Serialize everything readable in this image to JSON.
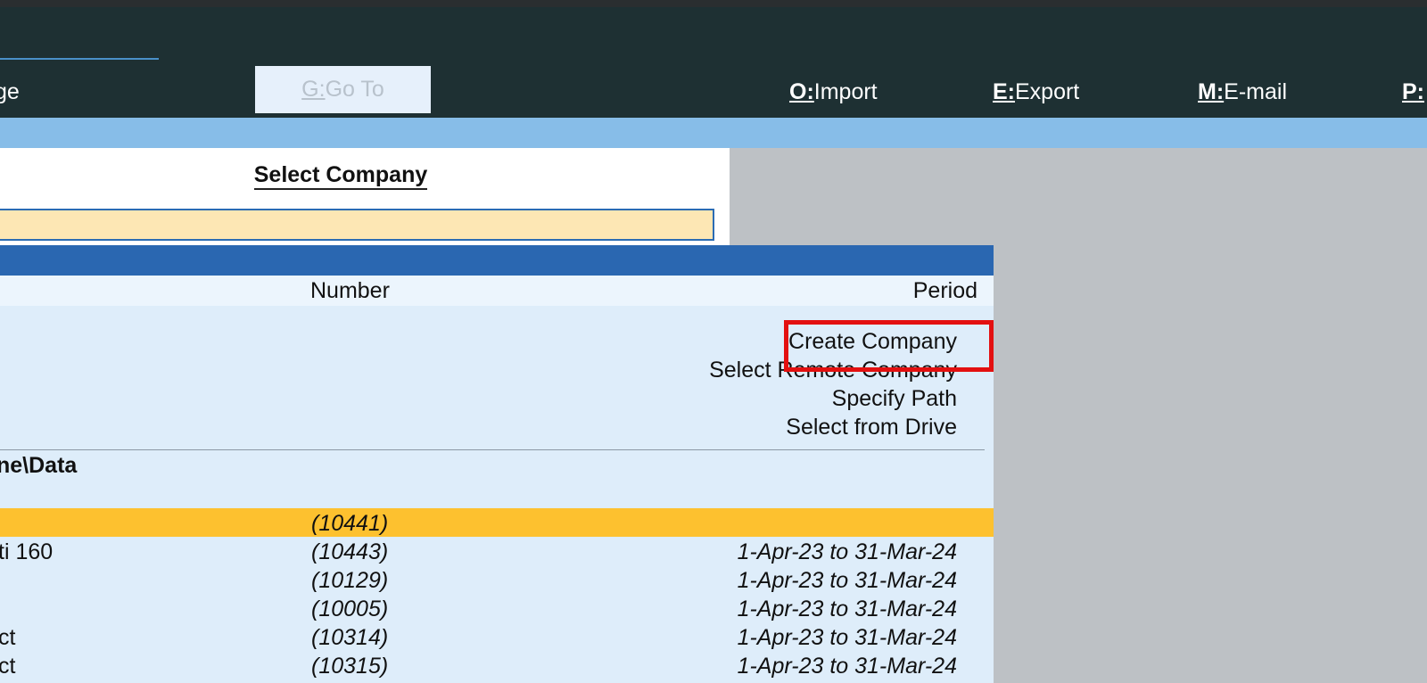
{
  "toolbar": {
    "partial_left_label": "ge",
    "goto": {
      "key": "G:",
      "label": "Go To"
    },
    "import": {
      "key": "O:",
      "label": "Import"
    },
    "export": {
      "key": "E:",
      "label": "Export"
    },
    "email": {
      "key": "M:",
      "label": "E-mail"
    },
    "print": {
      "key": "P:",
      "label": ""
    }
  },
  "select_company": {
    "title": "Select Company",
    "search_value": ""
  },
  "list": {
    "columns": {
      "number": "Number",
      "period": "Period"
    },
    "actions": [
      "Create Company",
      "Select Remote Company",
      "Specify Path",
      "Select from Drive"
    ],
    "path_label": "ne\\Data",
    "rows": [
      {
        "name": "",
        "number": "(10441)",
        "period": "",
        "selected": true
      },
      {
        "name": "ti 160",
        "number": "(10443)",
        "period": "1-Apr-23 to 31-Mar-24"
      },
      {
        "name": "",
        "number": "(10129)",
        "period": "1-Apr-23 to 31-Mar-24"
      },
      {
        "name": "",
        "number": "(10005)",
        "period": "1-Apr-23 to 31-Mar-24"
      },
      {
        "name": "ct",
        "number": "(10314)",
        "period": "1-Apr-23 to 31-Mar-24"
      },
      {
        "name": "ct",
        "number": "(10315)",
        "period": "1-Apr-23 to 31-Mar-24"
      }
    ]
  },
  "colors": {
    "toolbar_bg": "#1e3033",
    "accent_blue": "#2a67b1",
    "selected_row": "#fdc12f",
    "search_bg": "#fde7b4",
    "highlight_red": "#e31010"
  }
}
